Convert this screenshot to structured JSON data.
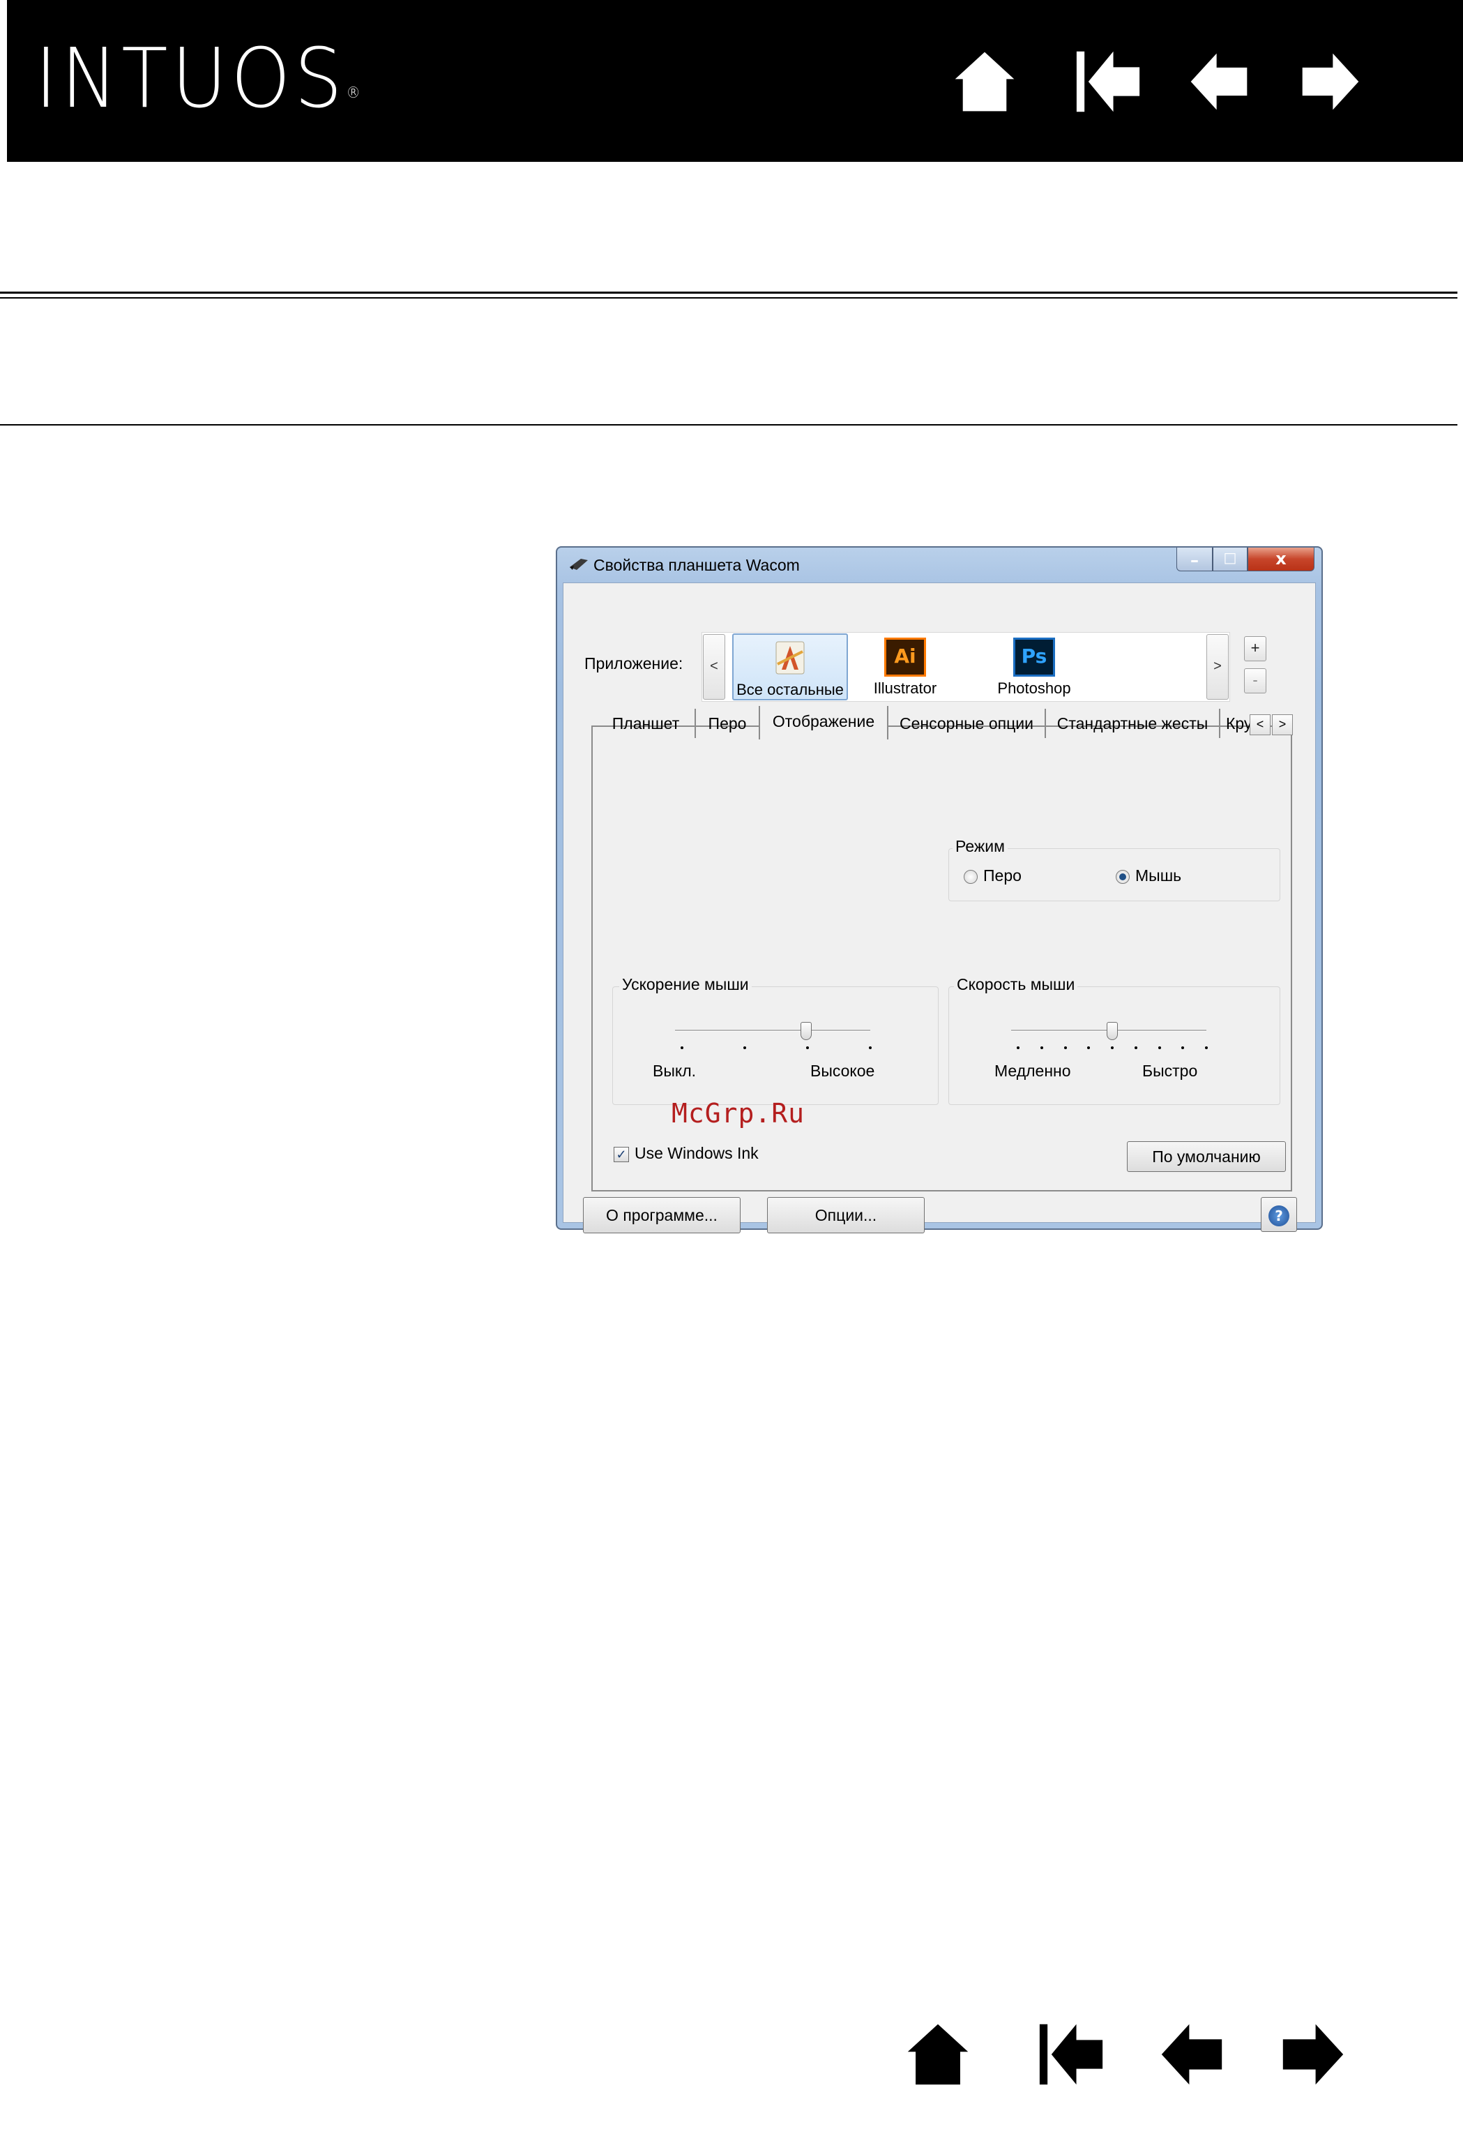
{
  "header": {
    "logo": "INTUOS",
    "logo_mark": "®",
    "nav": [
      {
        "name": "home-icon"
      },
      {
        "name": "first-page-icon"
      },
      {
        "name": "previous-page-icon"
      },
      {
        "name": "next-page-icon"
      }
    ]
  },
  "dialog": {
    "title": "Свойства планшета Wacom",
    "caption_buttons": {
      "minimize": "–",
      "maximize": "□",
      "close": "x"
    },
    "app_bar": {
      "label": "Приложение:",
      "scroll_left": "<",
      "scroll_right": ">",
      "add": "+",
      "remove": "-",
      "apps": [
        {
          "label": "Все остальные",
          "icon_text": "",
          "selected": true
        },
        {
          "label": "Illustrator",
          "icon_text": "Ai"
        },
        {
          "label": "Photoshop",
          "icon_text": "Ps"
        }
      ]
    },
    "tabs": [
      "Планшет",
      "Перо",
      "Отображение",
      "Сенсорные опции",
      "Стандартные жесты",
      "Кру"
    ],
    "active_tab": "Отображение",
    "tab_scroll_left": "<",
    "tab_scroll_right": ">",
    "mode_group": {
      "title": "Режим",
      "options": [
        "Перо",
        "Мышь"
      ],
      "selected": "Мышь"
    },
    "acceleration_group": {
      "title": "Ускорение мыши",
      "min_label": "Выкл.",
      "max_label": "Высокое",
      "ticks": 4,
      "value_fraction": 0.66
    },
    "speed_group": {
      "title": "Скорость мыши",
      "min_label": "Медленно",
      "max_label": "Быстро",
      "ticks": 9,
      "value_fraction": 0.5
    },
    "watermark": "McGrp.Ru",
    "use_windows_ink": {
      "label": "Use Windows Ink",
      "checked": true,
      "check_glyph": "✓"
    },
    "default_button": "По умолчанию",
    "about_button": "О программе...",
    "options_button": "Опции...",
    "help_glyph": "?",
    "colors": {
      "accent": "#1f5aa6",
      "close": "#c7452a",
      "ai": "#ff7a00",
      "ps": "#1b6ec2"
    }
  }
}
